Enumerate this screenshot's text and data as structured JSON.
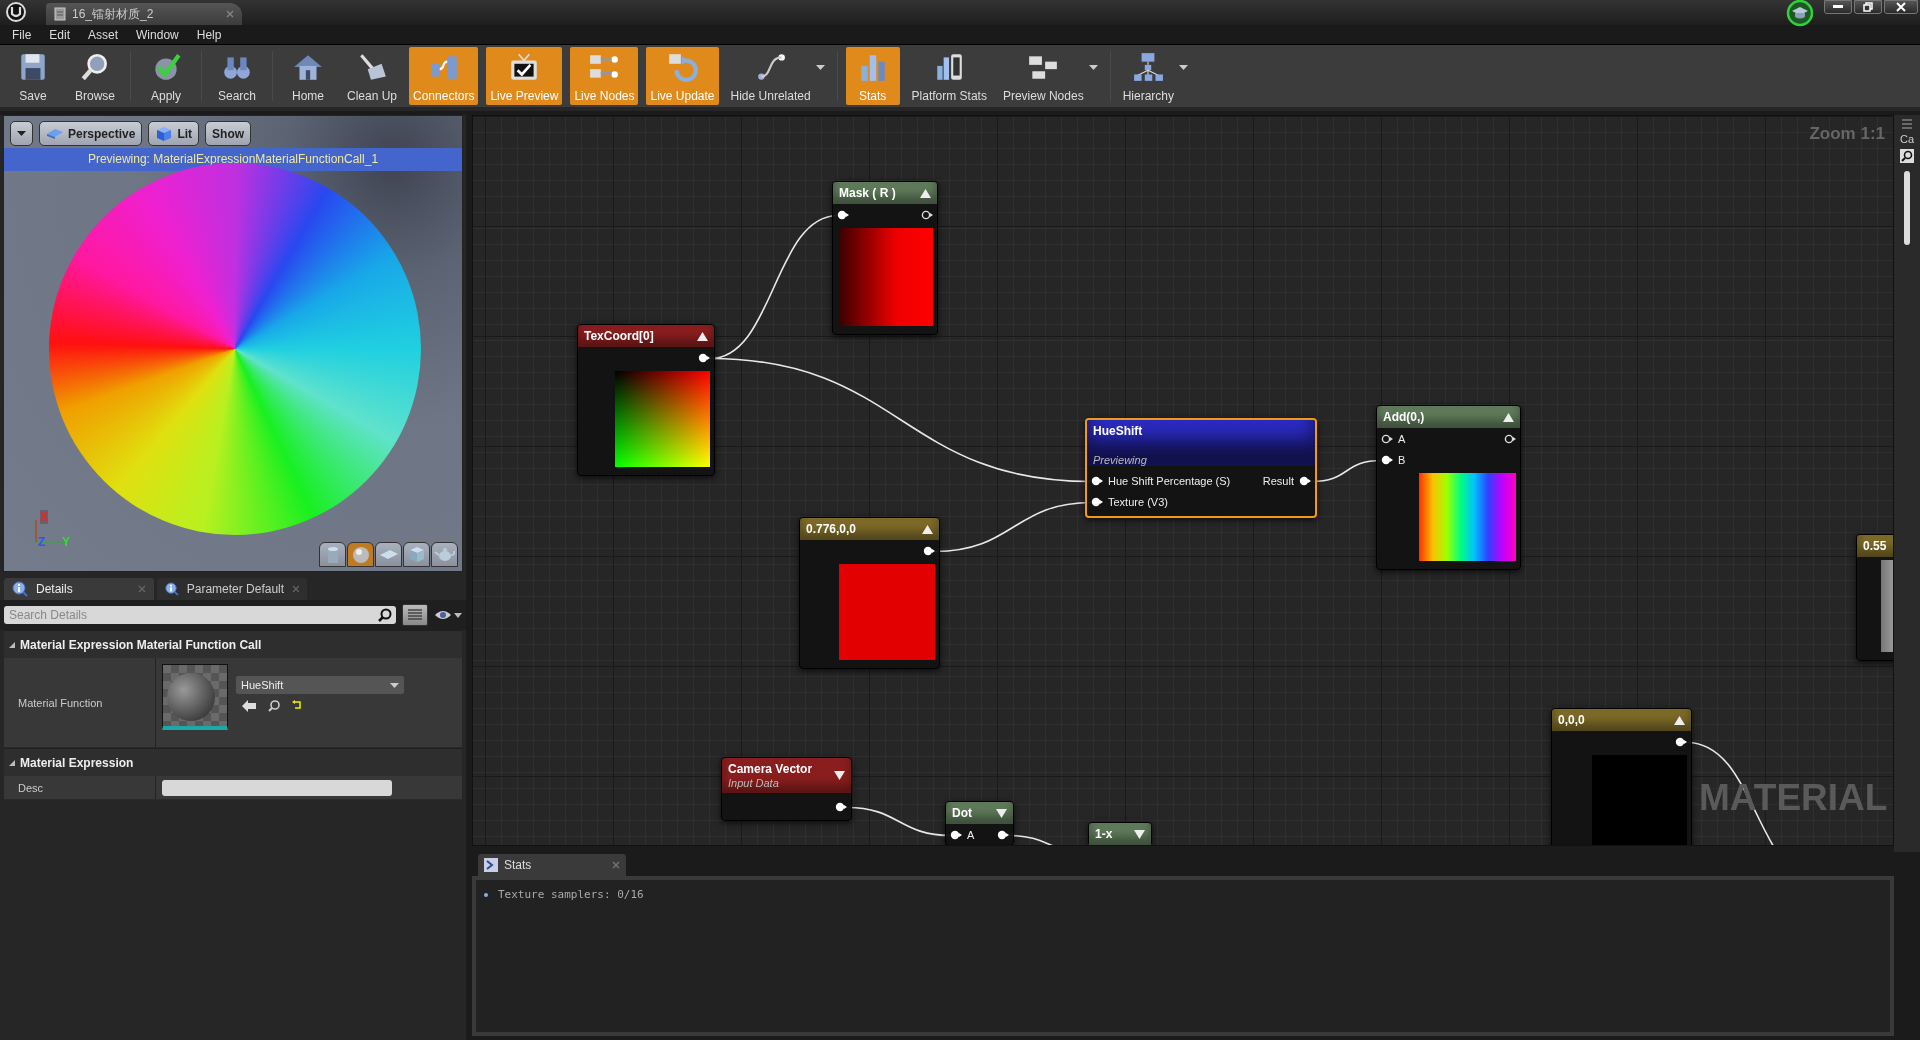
{
  "window": {
    "tab": "16_镭射材质_2"
  },
  "menu": [
    "File",
    "Edit",
    "Asset",
    "Window",
    "Help"
  ],
  "toolbar": [
    [
      {
        "label": "Save",
        "on": false,
        "dropdown": false
      },
      {
        "label": "Browse",
        "on": false,
        "dropdown": false
      }
    ],
    [
      {
        "label": "Apply",
        "on": false,
        "dropdown": false
      }
    ],
    [
      {
        "label": "Search",
        "on": false,
        "dropdown": false
      }
    ],
    [
      {
        "label": "Home",
        "on": false,
        "dropdown": false
      },
      {
        "label": "Clean Up",
        "on": false,
        "dropdown": false
      },
      {
        "label": "Connectors",
        "on": true,
        "dropdown": false
      },
      {
        "label": "Live Preview",
        "on": true,
        "dropdown": false
      },
      {
        "label": "Live Nodes",
        "on": true,
        "dropdown": false
      },
      {
        "label": "Live Update",
        "on": true,
        "dropdown": false
      },
      {
        "label": "Hide Unrelated",
        "on": false,
        "dropdown": true
      }
    ],
    [
      {
        "label": "Stats",
        "on": true,
        "dropdown": false
      },
      {
        "label": "Platform Stats",
        "on": false,
        "dropdown": false
      },
      {
        "label": "Preview Nodes",
        "on": false,
        "dropdown": true
      }
    ],
    [
      {
        "label": "Hierarchy",
        "on": false,
        "dropdown": true
      }
    ]
  ],
  "viewport": {
    "buttons": [
      {
        "label": "Perspective"
      },
      {
        "label": "Lit"
      },
      {
        "label": "Show"
      }
    ],
    "banner": "Previewing: MaterialExpressionMaterialFunctionCall_1",
    "axes": [
      "X",
      "Z",
      "Y"
    ],
    "shapes": [
      {
        "selected": false
      },
      {
        "selected": true
      },
      {
        "selected": false
      },
      {
        "selected": false
      },
      {
        "selected": false
      }
    ]
  },
  "details": {
    "tabs": [
      {
        "label": "Details",
        "selected": true
      },
      {
        "label": "Parameter Default",
        "selected": false
      }
    ],
    "search": {
      "placeholder": "Search Details"
    },
    "sections": [
      {
        "title": "Material Expression Material Function Call",
        "rows": [
          {
            "kind": "asset",
            "label": "Material Function",
            "value": "HueShift"
          }
        ]
      },
      {
        "title": "Material Expression",
        "rows": [
          {
            "kind": "text",
            "label": "Desc"
          }
        ]
      }
    ]
  },
  "graph": {
    "zoom": "Zoom 1:1",
    "watermark": "MATERIAL",
    "nodes": [
      {
        "kind": "preview",
        "title": "Mask ( R )",
        "color": "#5f7a5a",
        "expanded": true,
        "selected": false,
        "rows": [
          {
            "in": {
              "connected": true
            },
            "out": {
              "connected": false
            }
          }
        ]
      },
      {
        "kind": "preview",
        "title": "TexCoord[0]",
        "color": "#8a1e1e",
        "expanded": true,
        "selected": false,
        "rows": [
          {
            "out": {
              "connected": true
            }
          }
        ]
      },
      {
        "kind": "function",
        "title": "HueShift",
        "subtitle": "Previewing",
        "color": "#2a2ac0",
        "selected": true,
        "rows": [
          {
            "in": {
              "label": "Hue Shift Percentage (S)",
              "connected": true
            },
            "out": {
              "label": "Result",
              "connected": true
            }
          },
          {
            "in": {
              "label": "Texture (V3)",
              "connected": true
            }
          }
        ]
      },
      {
        "kind": "preview",
        "title": "Add(0,)",
        "color": "#5f7a5a",
        "expanded": true,
        "selected": false,
        "rows": [
          {
            "in": {
              "label": "A",
              "connected": false
            },
            "out": {
              "connected": false
            }
          },
          {
            "in": {
              "label": "B",
              "connected": true
            }
          }
        ]
      },
      {
        "kind": "preview",
        "title": "0.776,0,0",
        "color": "#7d6a28",
        "expanded": true,
        "selected": false,
        "rows": [
          {
            "out": {
              "connected": true
            }
          }
        ]
      },
      {
        "kind": "preview",
        "title": "0.55",
        "color": "#7d6a28",
        "selected": false
      },
      {
        "kind": "preview",
        "title": "0,0,0",
        "color": "#7d6a28",
        "expanded": true,
        "selected": false,
        "rows": [
          {
            "out": {
              "connected": true
            }
          }
        ]
      },
      {
        "kind": "input",
        "title": "Camera Vector",
        "subtitle": "Input Data",
        "color": "#8a1e1e",
        "expanded": false,
        "selected": false,
        "rows": [
          {
            "out": {
              "connected": true
            }
          }
        ]
      },
      {
        "kind": "compact",
        "title": "Dot",
        "color": "#5f7a5a",
        "expanded": false,
        "selected": false,
        "rows": [
          {
            "in": {
              "label": "A",
              "connected": true
            },
            "out": {
              "connected": true
            }
          }
        ]
      },
      {
        "kind": "compact",
        "title": "1-x",
        "color": "#5f7a5a",
        "expanded": false,
        "selected": false
      }
    ]
  },
  "side_strip": {
    "label": "Ca"
  },
  "stats": {
    "tab": "Stats",
    "lines": [
      "Texture samplers: 0/16"
    ]
  }
}
